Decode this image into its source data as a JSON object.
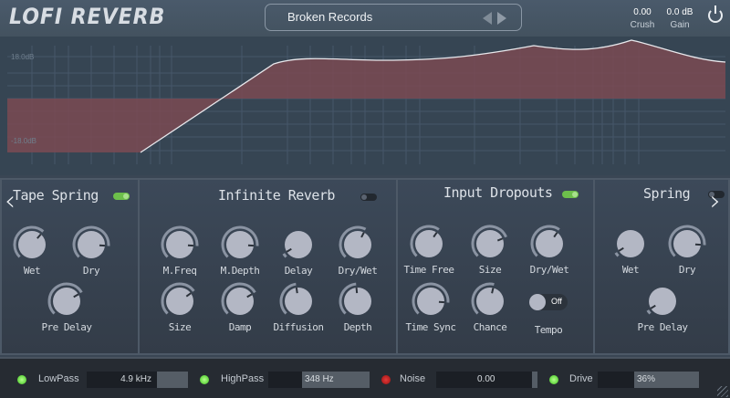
{
  "header": {
    "logo": "LOFI REVERB",
    "preset": "Broken Records",
    "crush": {
      "value": "0.00",
      "label": "Crush"
    },
    "gain": {
      "value": "0.0 dB",
      "label": "Gain"
    }
  },
  "eq": {
    "top_label": "18.0dB",
    "bottom_label": "-18.0dB",
    "nodes": [
      "2",
      "0",
      "1"
    ],
    "fill_color": "#7a4a52"
  },
  "panels": {
    "tape_spring": {
      "title": "Tape Spring",
      "enabled": true,
      "knobs": [
        {
          "label": "Wet",
          "value": 0.65
        },
        {
          "label": "Dry",
          "value": 0.85
        },
        {
          "label": "Pre Delay",
          "value": 0.72
        }
      ]
    },
    "infinite_reverb": {
      "title": "Infinite Reverb",
      "enabled": false,
      "knobs": [
        {
          "label": "M.Freq",
          "value": 0.85
        },
        {
          "label": "M.Depth",
          "value": 0.85
        },
        {
          "label": "Delay",
          "value": 0.05
        },
        {
          "label": "Dry/Wet",
          "value": 0.6
        },
        {
          "label": "Size",
          "value": 0.7
        },
        {
          "label": "Damp",
          "value": 0.72
        },
        {
          "label": "Diffusion",
          "value": 0.47
        },
        {
          "label": "Depth",
          "value": 0.48
        }
      ]
    },
    "input_dropouts": {
      "title": "Input Dropouts",
      "enabled": true,
      "knobs": [
        {
          "label": "Time Free",
          "value": 0.63
        },
        {
          "label": "Size",
          "value": 0.75
        },
        {
          "label": "Dry/Wet",
          "value": 0.63
        },
        {
          "label": "Time Sync",
          "value": 0.85
        },
        {
          "label": "Chance",
          "value": 0.55
        }
      ],
      "tempo": {
        "label": "Tempo",
        "state": "Off"
      }
    },
    "spring": {
      "title": "Spring",
      "enabled": false,
      "knobs": [
        {
          "label": "Wet",
          "value": 0.05
        },
        {
          "label": "Dry",
          "value": 0.85
        },
        {
          "label": "Pre Delay",
          "value": 0.05
        }
      ]
    }
  },
  "bottom": {
    "lowpass": {
      "label": "LowPass",
      "value": "4.9 kHz",
      "enabled": true,
      "fill": 0.7
    },
    "highpass": {
      "label": "HighPass",
      "value": "348 Hz",
      "enabled": true,
      "fill": 0.65
    },
    "noise": {
      "label": "Noise",
      "value": "0.00",
      "enabled": false,
      "fill": 0.0
    },
    "drive": {
      "label": "Drive",
      "value": "36%",
      "enabled": true,
      "fill": 0.64
    }
  },
  "colors": {
    "led_on": "#3dc21c",
    "led_off": "#9a1212",
    "toggle_on": "#6dbf4b"
  }
}
